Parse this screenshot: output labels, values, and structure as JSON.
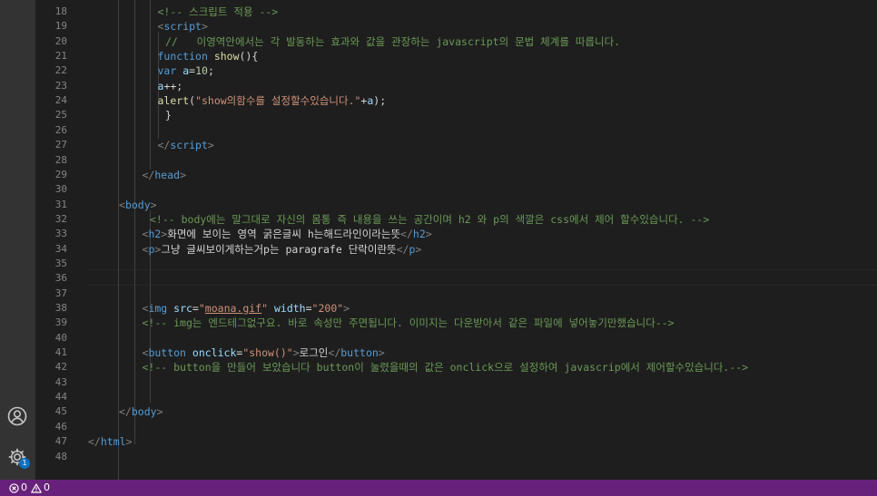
{
  "editor": {
    "lines": [
      {
        "n": "18",
        "i": 9,
        "tokens": [
          [
            "t-comment",
            "<!-- 스크립트 적용 -->"
          ]
        ]
      },
      {
        "n": "19",
        "i": 9,
        "tokens": [
          [
            "t-bracket",
            "<"
          ],
          [
            "t-tag",
            "script"
          ],
          [
            "t-bracket",
            ">"
          ]
        ]
      },
      {
        "n": "20",
        "i": 10,
        "tokens": [
          [
            "t-comment",
            "//   이영역안에서는 각 발동하는 효과와 값을 관장하는 javascript의 문법 체계를 따릅니다."
          ]
        ]
      },
      {
        "n": "21",
        "i": 9,
        "tokens": [
          [
            "t-kw",
            "function "
          ],
          [
            "t-fn",
            "show"
          ],
          [
            "t-text",
            "(){"
          ]
        ]
      },
      {
        "n": "22",
        "i": 9,
        "tokens": [
          [
            "t-kw",
            "var "
          ],
          [
            "t-var",
            "a"
          ],
          [
            "t-text",
            "="
          ],
          [
            "t-num",
            "10"
          ],
          [
            "t-text",
            ";"
          ]
        ]
      },
      {
        "n": "23",
        "i": 9,
        "tokens": [
          [
            "t-var",
            "a"
          ],
          [
            "t-text",
            "++;"
          ]
        ]
      },
      {
        "n": "24",
        "i": 9,
        "tokens": [
          [
            "t-fn",
            "alert"
          ],
          [
            "t-text",
            "("
          ],
          [
            "t-str",
            "\"show의함수를 설정할수있습니다.\""
          ],
          [
            "t-text",
            "+"
          ],
          [
            "t-var",
            "a"
          ],
          [
            "t-text",
            ");"
          ]
        ]
      },
      {
        "n": "25",
        "i": 10,
        "tokens": [
          [
            "t-text",
            "}"
          ]
        ]
      },
      {
        "n": "26",
        "i": 0,
        "tokens": []
      },
      {
        "n": "27",
        "i": 9,
        "tokens": [
          [
            "t-bracket",
            "</"
          ],
          [
            "t-tag",
            "script"
          ],
          [
            "t-bracket",
            ">"
          ]
        ]
      },
      {
        "n": "28",
        "i": 0,
        "tokens": []
      },
      {
        "n": "29",
        "i": 7,
        "tokens": [
          [
            "t-bracket",
            "</"
          ],
          [
            "t-tag",
            "head"
          ],
          [
            "t-bracket",
            ">"
          ]
        ]
      },
      {
        "n": "30",
        "i": 0,
        "tokens": []
      },
      {
        "n": "31",
        "i": 4,
        "tokens": [
          [
            "t-bracket",
            "<"
          ],
          [
            "t-tag",
            "body"
          ],
          [
            "t-bracket",
            ">"
          ]
        ]
      },
      {
        "n": "32",
        "i": 8,
        "tokens": [
          [
            "t-comment",
            "<!-- body에는 말그대로 자신의 몸통 즉 내용을 쓰는 공간이며 h2 와 p의 색깔은 css에서 제어 할수있습니다. -->"
          ]
        ]
      },
      {
        "n": "33",
        "i": 7,
        "tokens": [
          [
            "t-bracket",
            "<"
          ],
          [
            "t-tag",
            "h2"
          ],
          [
            "t-bracket",
            ">"
          ],
          [
            "t-text",
            "화면에 보이는 영역 굵은글씨 h는해드라인이라는뜻"
          ],
          [
            "t-bracket",
            "</"
          ],
          [
            "t-tag",
            "h2"
          ],
          [
            "t-bracket",
            ">"
          ]
        ]
      },
      {
        "n": "34",
        "i": 7,
        "tokens": [
          [
            "t-bracket",
            "<"
          ],
          [
            "t-tag",
            "p"
          ],
          [
            "t-bracket",
            ">"
          ],
          [
            "t-text",
            "그냥 글씨보이게하는거p는 paragrafe 단락이란뜻"
          ],
          [
            "t-bracket",
            "</"
          ],
          [
            "t-tag",
            "p"
          ],
          [
            "t-bracket",
            ">"
          ]
        ]
      },
      {
        "n": "35",
        "i": 0,
        "tokens": []
      },
      {
        "n": "36",
        "i": 0,
        "tokens": []
      },
      {
        "n": "37",
        "i": 0,
        "tokens": []
      },
      {
        "n": "38",
        "i": 7,
        "tokens": [
          [
            "t-bracket",
            "<"
          ],
          [
            "t-tag",
            "img "
          ],
          [
            "t-attr",
            "src"
          ],
          [
            "t-text",
            "="
          ],
          [
            "t-str",
            "\""
          ],
          [
            "t-link",
            "moana.gif"
          ],
          [
            "t-str",
            "\""
          ],
          [
            "t-text",
            " "
          ],
          [
            "t-attr",
            "width"
          ],
          [
            "t-text",
            "="
          ],
          [
            "t-str",
            "\"200\""
          ],
          [
            "t-bracket",
            ">"
          ]
        ]
      },
      {
        "n": "39",
        "i": 7,
        "tokens": [
          [
            "t-comment",
            "<!-- img는 엔드테그없구요. 바로 속성만 주면됩니다. 이미지는 다운받아서 같은 파일에 넣어놓기만했습니다-->"
          ]
        ]
      },
      {
        "n": "40",
        "i": 0,
        "tokens": []
      },
      {
        "n": "41",
        "i": 7,
        "tokens": [
          [
            "t-bracket",
            "<"
          ],
          [
            "t-tag",
            "button "
          ],
          [
            "t-attr",
            "onclick"
          ],
          [
            "t-text",
            "="
          ],
          [
            "t-str",
            "\"show()\""
          ],
          [
            "t-bracket",
            ">"
          ],
          [
            "t-text",
            "로그인"
          ],
          [
            "t-bracket",
            "</"
          ],
          [
            "t-tag",
            "button"
          ],
          [
            "t-bracket",
            ">"
          ]
        ]
      },
      {
        "n": "42",
        "i": 7,
        "tokens": [
          [
            "t-comment",
            "<!-- button을 만들어 보았습니다 button이 눌렸을때의 값은 onclick으로 설정하여 javascrip에서 제어할수있습니다.-->"
          ]
        ]
      },
      {
        "n": "43",
        "i": 0,
        "tokens": []
      },
      {
        "n": "44",
        "i": 0,
        "tokens": []
      },
      {
        "n": "45",
        "i": 4,
        "tokens": [
          [
            "t-bracket",
            "</"
          ],
          [
            "t-tag",
            "body"
          ],
          [
            "t-bracket",
            ">"
          ]
        ]
      },
      {
        "n": "46",
        "i": 0,
        "tokens": []
      },
      {
        "n": "47",
        "i": 0,
        "tokens": [
          [
            "t-bracket",
            "</"
          ],
          [
            "t-tag",
            "html"
          ],
          [
            "t-bracket",
            ">"
          ]
        ]
      },
      {
        "n": "48",
        "i": 0,
        "tokens": []
      }
    ]
  },
  "activity_bar": {
    "accounts_icon": "account-icon",
    "manage_icon": "gear-icon",
    "manage_badge": "1"
  },
  "status_bar": {
    "errors_icon": "error-icon",
    "errors_count": "0",
    "warnings_icon": "warning-icon",
    "warnings_count": "0",
    "background": "#68217a"
  }
}
